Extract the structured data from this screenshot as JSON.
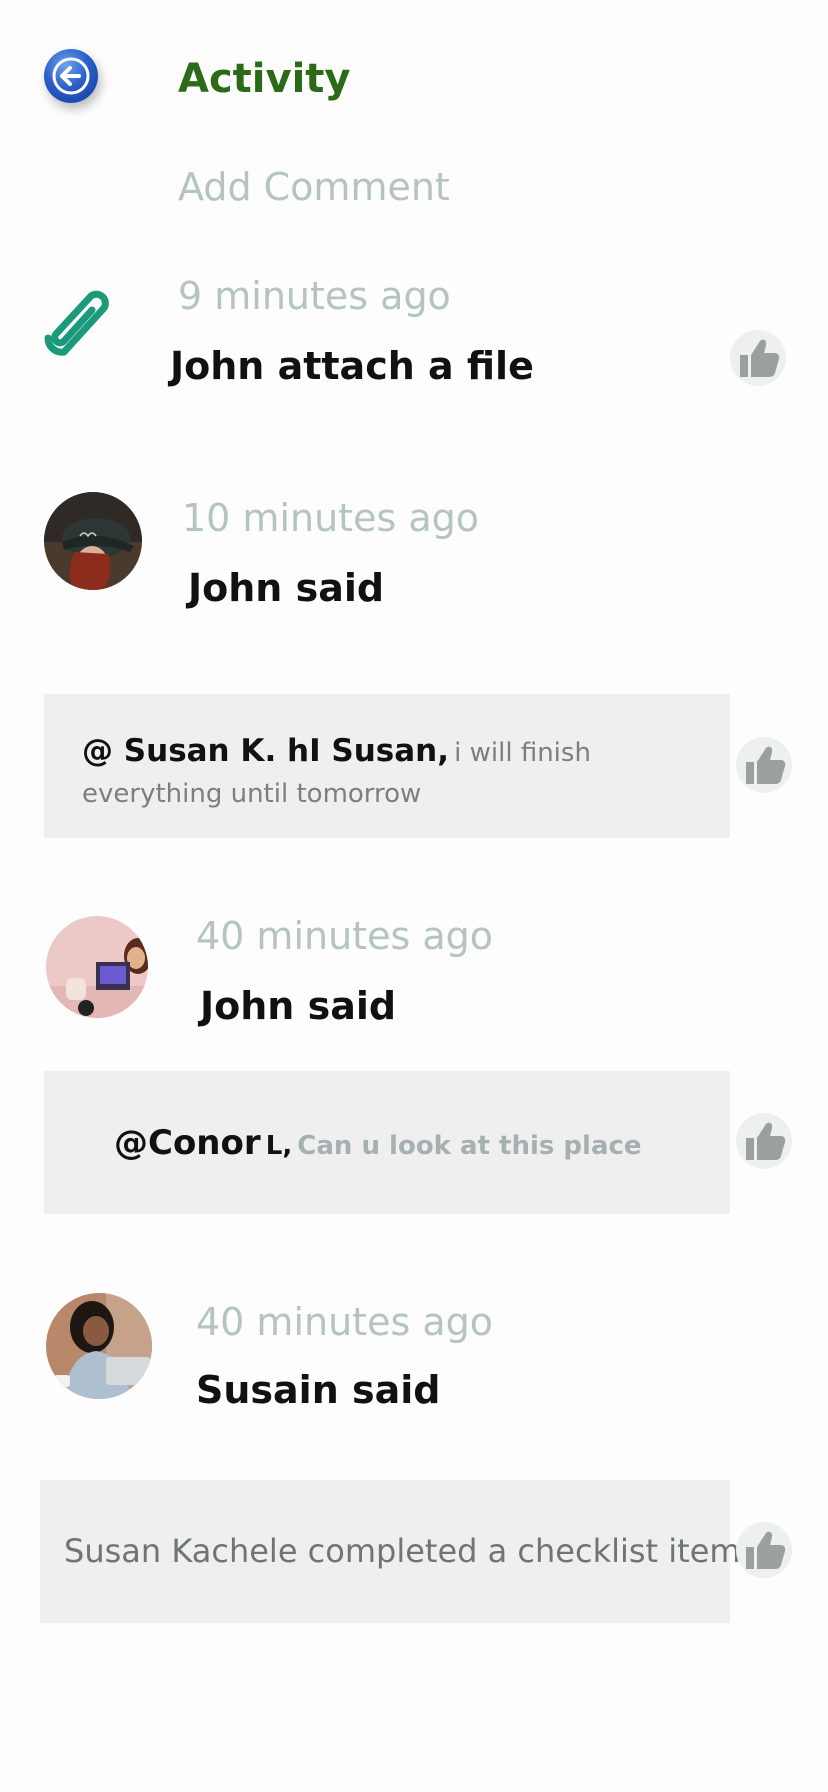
{
  "header": {
    "back_icon": "arrow-left-icon",
    "title": "Activity",
    "add_comment_placeholder": "Add Comment"
  },
  "feed": [
    {
      "time": "9 minutes ago",
      "action": "John attach a file",
      "icon": "paperclip-icon"
    },
    {
      "time": "10 minutes ago",
      "action": "John said",
      "comment": {
        "mention": "@ Susan K. hI Susan,",
        "text": "i will finish everything until tomorrow"
      }
    },
    {
      "time": "40 minutes ago",
      "action": "John said",
      "comment": {
        "mention": "@Conor",
        "mention_suffix": "L,",
        "text": "Can u look at this place"
      }
    },
    {
      "time": "40 minutes ago",
      "action": "Susain said",
      "comment": {
        "text": "Susan Kachele completed a checklist item"
      }
    }
  ],
  "colors": {
    "title": "#2b6a17",
    "muted": "#b4c4c2",
    "comment_bg": "#efefef",
    "paperclip": "#1a9a7a",
    "back_button": "#2a5fc8"
  }
}
